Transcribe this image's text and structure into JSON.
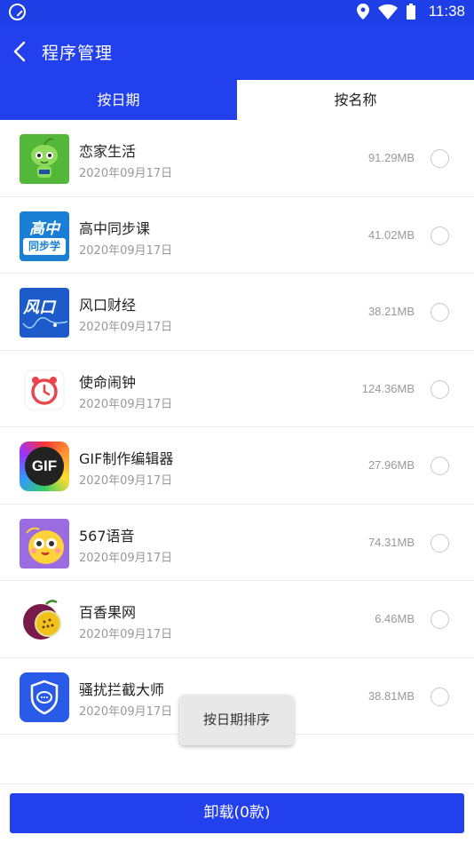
{
  "status_bar": {
    "time": "11:38"
  },
  "header": {
    "title": "程序管理"
  },
  "tabs": [
    {
      "label": "按日期"
    },
    {
      "label": "按名称"
    }
  ],
  "apps": [
    {
      "name": "恋家生活",
      "date": "2020年09月17日",
      "size": "91.29MB",
      "icon": "green-mascot-icon"
    },
    {
      "name": "高中同步课",
      "date": "2020年09月17日",
      "size": "41.02MB",
      "icon": "gaozhong-tongbuxue-icon"
    },
    {
      "name": "风口财经",
      "date": "2020年09月17日",
      "size": "38.21MB",
      "icon": "fengkou-icon"
    },
    {
      "name": "使命闹钟",
      "date": "2020年09月17日",
      "size": "124.36MB",
      "icon": "alarm-clock-icon"
    },
    {
      "name": "GIF制作编辑器",
      "date": "2020年09月17日",
      "size": "27.96MB",
      "icon": "gif-icon"
    },
    {
      "name": "567语音",
      "date": "2020年09月17日",
      "size": "74.31MB",
      "icon": "yellow-mascot-icon"
    },
    {
      "name": "百香果网",
      "date": "2020年09月17日",
      "size": "6.46MB",
      "icon": "passion-fruit-icon"
    },
    {
      "name": "骚扰拦截大师",
      "date": "2020年09月17日",
      "size": "38.81MB",
      "icon": "shield-chat-icon"
    }
  ],
  "toast": {
    "text": "按日期排序"
  },
  "footer": {
    "uninstall_label": "卸载(0款)"
  },
  "icon_text": {
    "gaozhong_top": "高中",
    "gaozhong_bottom": "同步学",
    "fengkou": "风口",
    "gif": "GIF"
  },
  "colors": {
    "primary": "#2340ef",
    "status_bar": "#1f3fe6"
  }
}
